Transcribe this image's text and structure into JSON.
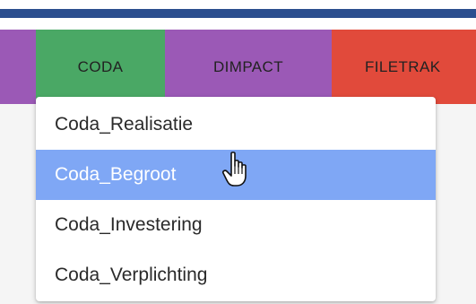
{
  "tabs": [
    {
      "label": ""
    },
    {
      "label": "CODA"
    },
    {
      "label": "DIMPACT"
    },
    {
      "label": "FILETRAK"
    }
  ],
  "dropdown": {
    "items": [
      {
        "label": "Coda_Realisatie"
      },
      {
        "label": "Coda_Begroot"
      },
      {
        "label": "Coda_Investering"
      },
      {
        "label": "Coda_Verplichting"
      }
    ],
    "highlighted_index": 1
  },
  "colors": {
    "top_bar": "#2b4f8f",
    "tab_purple": "#9b59b6",
    "tab_green": "#4aa865",
    "tab_red": "#e14a3b",
    "highlight": "#7fa7f5"
  },
  "cursor": {
    "icon": "hand-pointer-icon"
  }
}
